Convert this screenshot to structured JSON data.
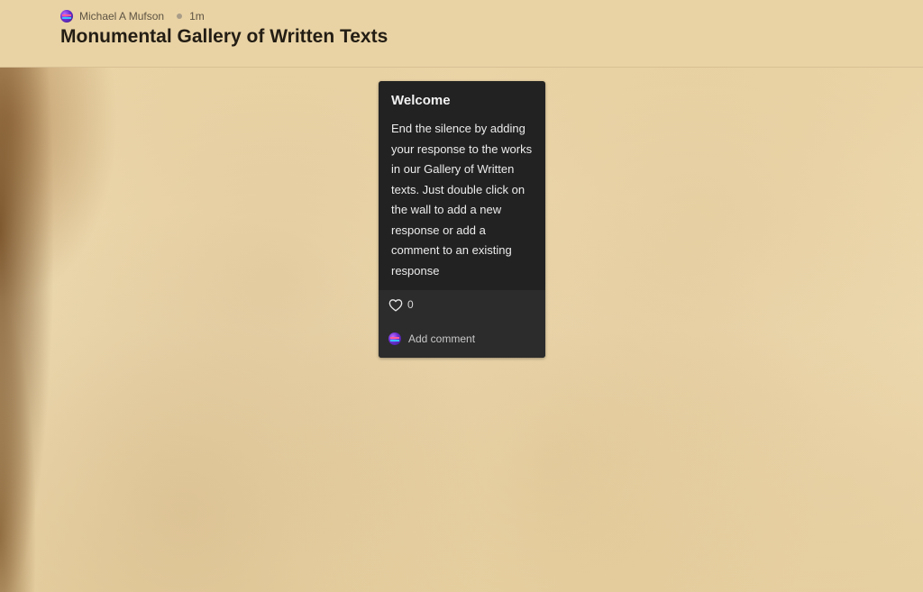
{
  "header": {
    "author": "Michael A Mufson",
    "time": "1m",
    "title": "Monumental Gallery of Written Texts"
  },
  "post": {
    "title": "Welcome",
    "body": "End the silence by adding your response to the works in our Gallery of Written texts. Just double click on the wall to add a new response or add a comment to an existing response",
    "likes": "0",
    "add_comment_label": "Add comment"
  },
  "icons": {
    "avatar": "avatar-icon",
    "like": "heart-icon"
  },
  "colors": {
    "card_background": "#222222",
    "card_footer": "#2c2c2c",
    "header_background": "#e9d3a5",
    "title_text": "#231d14"
  }
}
